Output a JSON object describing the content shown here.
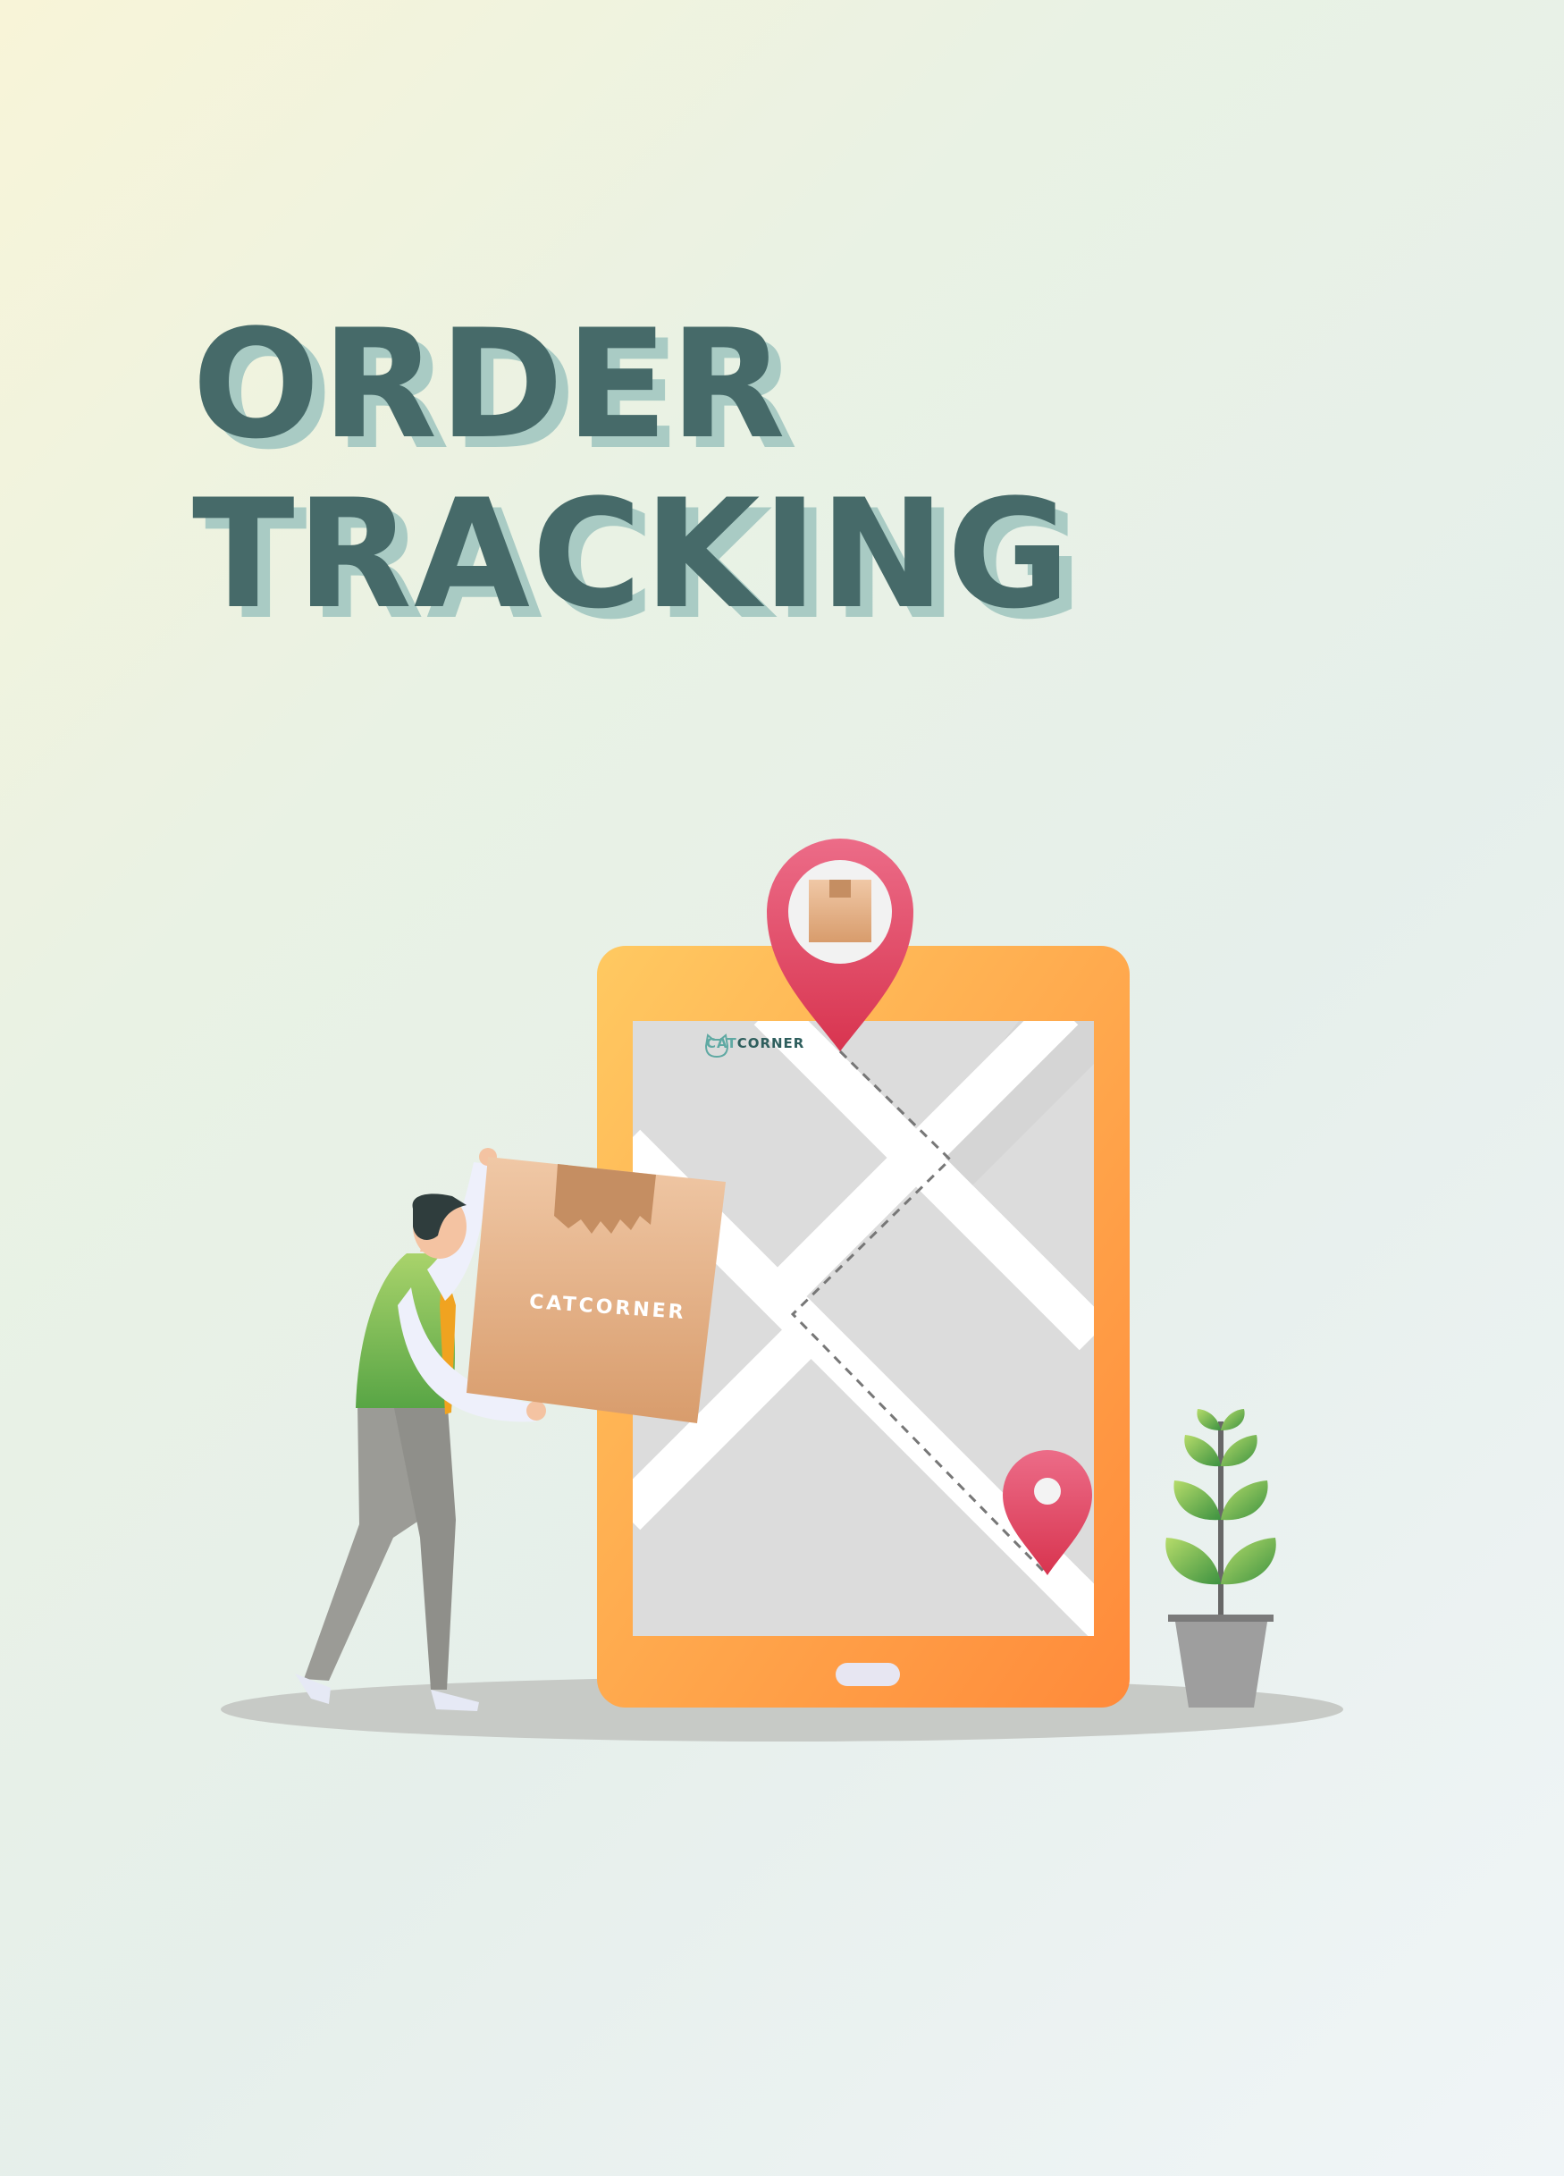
{
  "title": {
    "line1": "ORDER",
    "line2": "TRACKING"
  },
  "brand": {
    "screen_logo_cat": "CAT",
    "screen_logo_corner": "CORNER",
    "box_logo": "CATCORNER"
  },
  "colors": {
    "title": "#466a69",
    "title_shadow": "#a9cbc4",
    "tablet": "#ff9a3c",
    "pin": "#e04d6d",
    "box": "#e0a77e",
    "shirt": "#6fb14a",
    "plant": "#57a84a"
  },
  "icons": [
    "location-pin-icon",
    "package-icon",
    "cat-logo-icon"
  ]
}
